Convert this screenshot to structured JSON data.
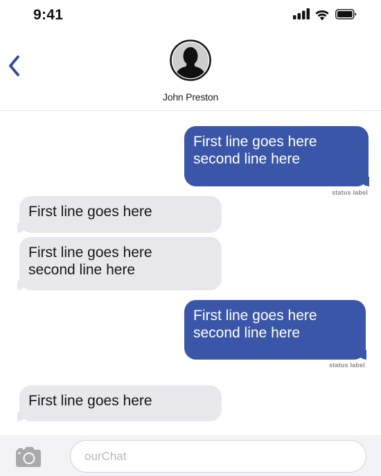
{
  "status_bar": {
    "time": "9:41",
    "icons": [
      "signal-icon",
      "wifi-icon",
      "battery-icon"
    ]
  },
  "header": {
    "back_icon": "chevron-left-icon",
    "avatar_icon": "person-silhouette-icon",
    "contact_name": "John Preston"
  },
  "messages": [
    {
      "side": "sent",
      "lines": [
        "First line goes here",
        "second line here"
      ],
      "status": "status label"
    },
    {
      "side": "received",
      "lines": [
        "First line goes here"
      ]
    },
    {
      "side": "received",
      "lines": [
        "First line goes here",
        "second line here"
      ]
    },
    {
      "side": "sent",
      "lines": [
        "First line goes here",
        "second line here"
      ],
      "status": "status label"
    },
    {
      "side": "received",
      "lines": [
        "First line goes here"
      ]
    }
  ],
  "composer": {
    "camera_icon": "camera-icon",
    "placeholder": "ourChat",
    "value": ""
  },
  "colors": {
    "sent_bubble": "#3a56a8",
    "received_bubble": "#e8e8ec",
    "accent": "#2c4a9e"
  }
}
